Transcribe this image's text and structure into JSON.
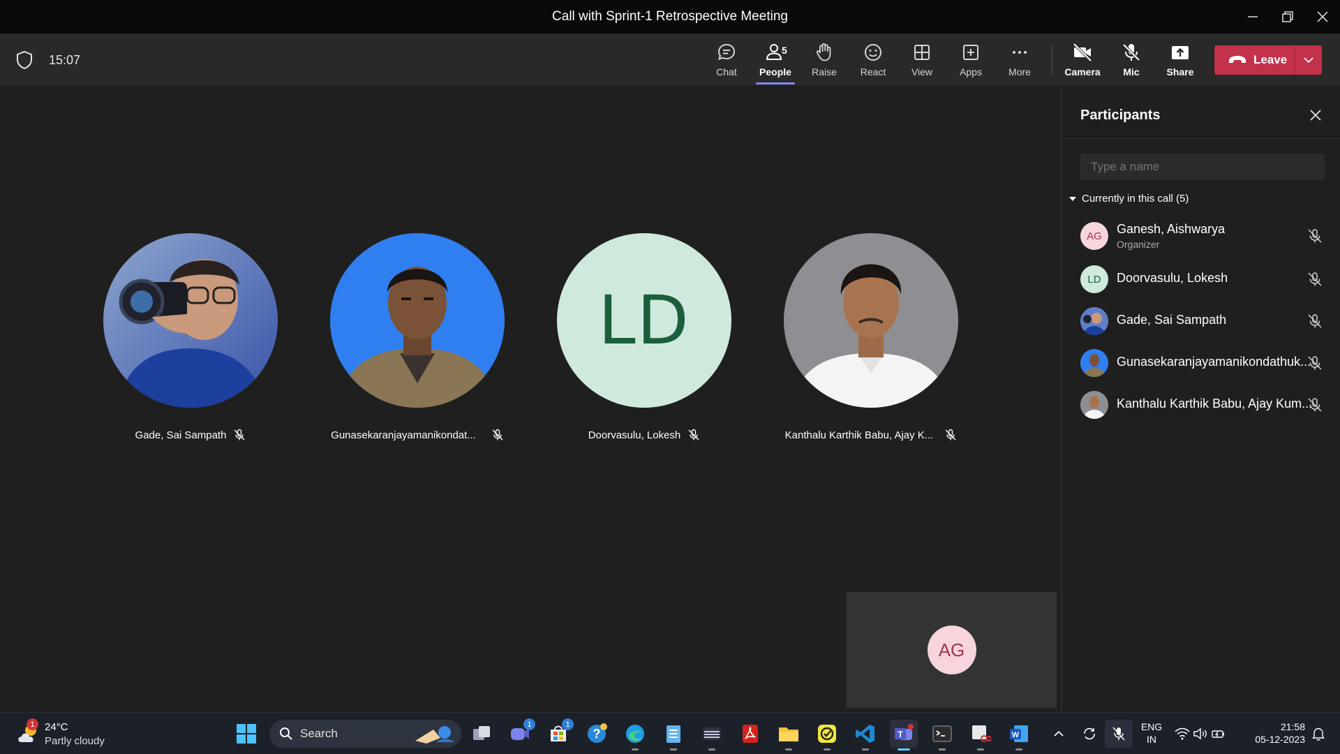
{
  "window": {
    "title": "Call with Sprint-1 Retrospective Meeting"
  },
  "toolbar": {
    "timer": "15:07",
    "people_count": "5",
    "buttons": {
      "chat": "Chat",
      "people": "People",
      "raise": "Raise",
      "react": "React",
      "view": "View",
      "apps": "Apps",
      "more": "More",
      "camera": "Camera",
      "mic": "Mic",
      "share": "Share"
    },
    "leave_label": "Leave"
  },
  "stage": {
    "tiles": [
      {
        "name": "Gade, Sai Sampath"
      },
      {
        "name": "Gunasekaranjayamanikondat..."
      },
      {
        "name": "Doorvasulu, Lokesh",
        "initials": "LD"
      },
      {
        "name": "Kanthalu Karthik Babu, Ajay K..."
      }
    ],
    "self_initials": "AG"
  },
  "participants": {
    "title": "Participants",
    "search_placeholder": "Type a name",
    "section_label": "Currently in this call (5)",
    "list": [
      {
        "name": "Ganesh, Aishwarya",
        "role": "Organizer",
        "initials": "AG"
      },
      {
        "name": "Doorvasulu, Lokesh",
        "initials": "LD"
      },
      {
        "name": "Gade, Sai Sampath"
      },
      {
        "name": "Gunasekaranjayamanikondathuk..."
      },
      {
        "name": "Kanthalu Karthik Babu, Ajay Kum..."
      }
    ]
  },
  "taskbar": {
    "weather_temp": "24°C",
    "weather_cond": "Partly cloudy",
    "weather_badge": "1",
    "search_label": "Search",
    "teams_badge": "1",
    "store_badge": "1",
    "lang_line1": "ENG",
    "lang_line2": "IN",
    "time": "21:58",
    "date": "05-12-2023"
  },
  "colors": {
    "leave": "#c4314b",
    "accent": "#7f85f5",
    "ag_bg": "#f6d5dc",
    "ld_bg": "#cfeadc"
  }
}
